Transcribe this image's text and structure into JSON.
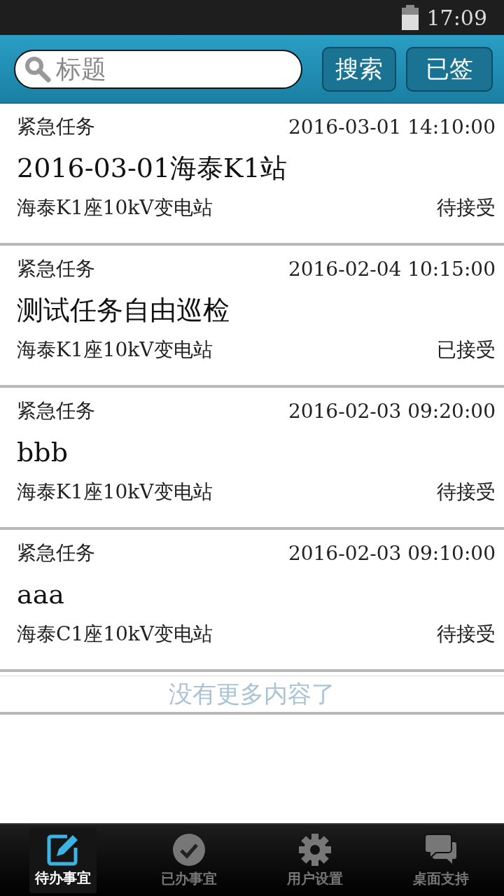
{
  "status_bar": {
    "time": "17:09"
  },
  "header": {
    "search": {
      "placeholder": "标题"
    },
    "buttons": [
      "搜索",
      "已签"
    ]
  },
  "tasks": [
    {
      "category": "紧急任务",
      "datetime": "2016-03-01 14:10:00",
      "title": "2016-03-01海泰K1站",
      "location": "海泰K1座10kV变电站",
      "status": "待接受"
    },
    {
      "category": "紧急任务",
      "datetime": "2016-02-04 10:15:00",
      "title": "测试任务自由巡检",
      "location": "海泰K1座10kV变电站",
      "status": "已接受"
    },
    {
      "category": "紧急任务",
      "datetime": "2016-02-03 09:20:00",
      "title": "bbb",
      "location": "海泰K1座10kV变电站",
      "status": "待接受"
    },
    {
      "category": "紧急任务",
      "datetime": "2016-02-03 09:10:00",
      "title": "aaa",
      "location": "海泰C1座10kV变电站",
      "status": "待接受"
    }
  ],
  "list_footer": "没有更多内容了",
  "tabs": [
    {
      "label": "待办事宜",
      "selected": true
    },
    {
      "label": "已办事宜",
      "selected": false
    },
    {
      "label": "用户设置",
      "selected": false
    },
    {
      "label": "桌面支持",
      "selected": false
    }
  ]
}
